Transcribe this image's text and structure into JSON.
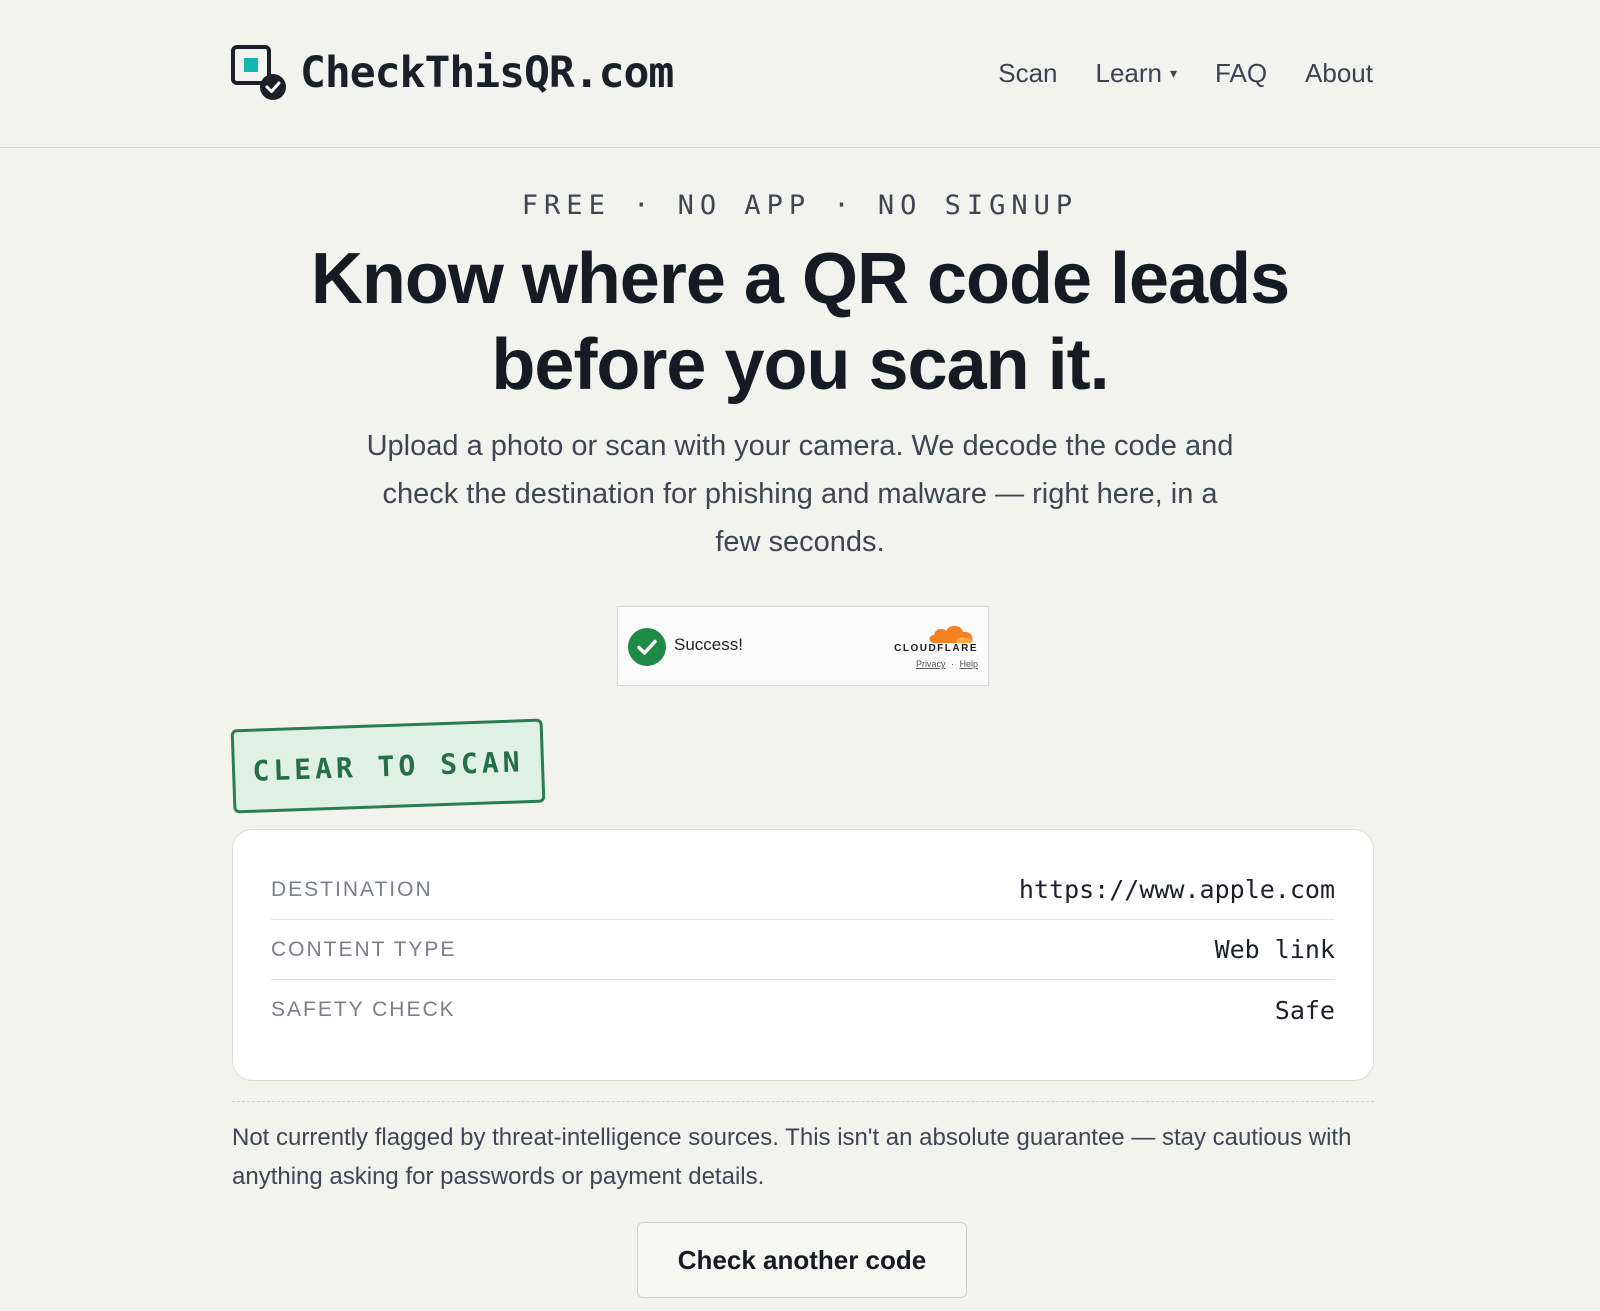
{
  "brand": {
    "name": "CheckThisQR.com",
    "logo_icon": "qr-check-icon"
  },
  "nav": {
    "items": [
      {
        "label": "Scan"
      },
      {
        "label": "Learn",
        "has_dropdown": true,
        "caret": "▾"
      },
      {
        "label": "FAQ"
      },
      {
        "label": "About"
      }
    ]
  },
  "hero": {
    "eyebrow": "FREE · NO APP · NO SIGNUP",
    "headline_line1": "Know where a QR code leads",
    "headline_line2": "before you scan it.",
    "subhead": "Upload a photo or scan with your camera. We decode the code and check the destination for phishing and malware — right here, in a few seconds."
  },
  "turnstile": {
    "status": "Success!",
    "provider": "CLOUDFLARE",
    "privacy_link": "Privacy",
    "separator": "·",
    "help_link": "Help",
    "check_color": "#1f8a45",
    "cloud_color": "#f48120"
  },
  "result": {
    "stamp": "CLEAR TO SCAN",
    "stamp_color": "#2a7d52",
    "rows": [
      {
        "label": "DESTINATION",
        "value": "https://www.apple.com"
      },
      {
        "label": "CONTENT TYPE",
        "value": "Web link"
      },
      {
        "label": "SAFETY CHECK",
        "value": "Safe"
      }
    ],
    "note": "Not currently flagged by threat-intelligence sources. This isn't an absolute guarantee — stay cautious with anything asking for passwords or payment details.",
    "cta_label": "Check another code"
  },
  "colors": {
    "accent_teal": "#16b5b0",
    "ink": "#1b1f27",
    "background": "#f2f2ef"
  }
}
